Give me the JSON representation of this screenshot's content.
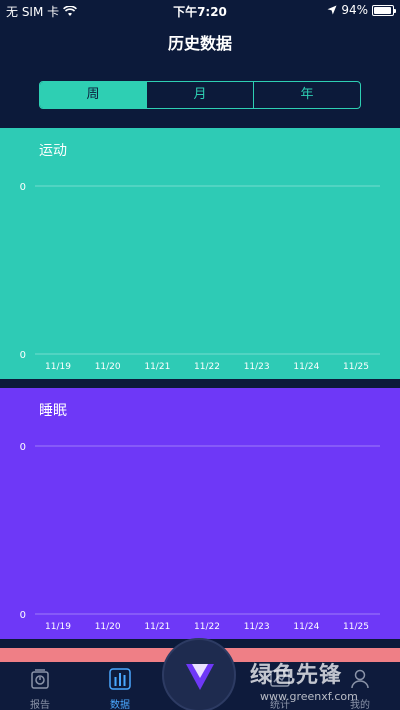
{
  "status_bar": {
    "carrier": "无 SIM 卡",
    "time": "下午7:20",
    "battery": "94%",
    "battery_level": 0.94
  },
  "header": {
    "title": "历史数据"
  },
  "segments": [
    {
      "label": "周",
      "active": true
    },
    {
      "label": "月",
      "active": false
    },
    {
      "label": "年",
      "active": false
    }
  ],
  "chart_data": [
    {
      "type": "line",
      "title": "运动",
      "categories": [
        "11/19",
        "11/20",
        "11/21",
        "11/22",
        "11/23",
        "11/24",
        "11/25"
      ],
      "y_ticks": [
        "0",
        "0"
      ],
      "series": [],
      "background": "#2ecbb5"
    },
    {
      "type": "line",
      "title": "睡眠",
      "categories": [
        "11/19",
        "11/20",
        "11/21",
        "11/22",
        "11/23",
        "11/24",
        "11/25"
      ],
      "y_ticks": [
        "0",
        "0"
      ],
      "series": [],
      "background": "#6e38f7"
    }
  ],
  "tab_bar": {
    "items": [
      {
        "label": "报告",
        "icon": "report-icon",
        "active": false
      },
      {
        "label": "数据",
        "icon": "bar-chart-icon",
        "active": true
      },
      {
        "label": "统计",
        "icon": "stats-icon",
        "active": false
      },
      {
        "label": "我的",
        "icon": "profile-icon",
        "active": false
      }
    ]
  },
  "watermark": {
    "text": "绿色先锋",
    "url": "www.greenxf.com"
  },
  "colors": {
    "background": "#0c1a3a",
    "accent": "#2ecfb3",
    "active_tab": "#4aa8ff",
    "strip": "#ef7f86"
  }
}
